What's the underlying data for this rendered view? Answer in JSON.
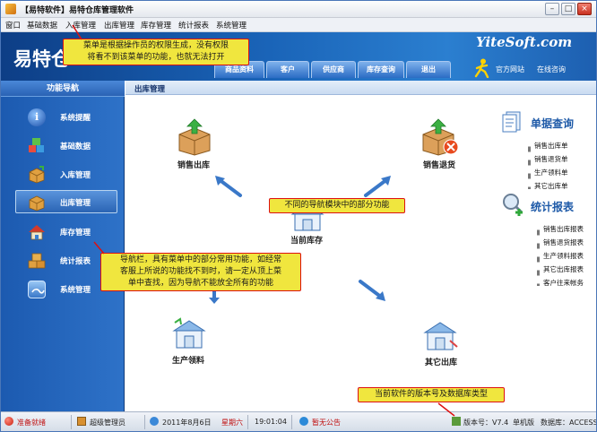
{
  "window": {
    "title": "【易特软件】易特仓库管理软件",
    "buttons": {
      "minimize": "–",
      "maximize": "□",
      "close": "×"
    }
  },
  "menubar": {
    "items": [
      "窗口",
      "基础数据",
      "入库管理",
      "出库管理",
      "库存管理",
      "统计报表",
      "系统管理"
    ]
  },
  "banner": {
    "logo_text": "易特仓",
    "brand": "YiteSoft.com",
    "nav_tabs": [
      "商品资料",
      "客户",
      "供应商",
      "库存查询",
      "退出"
    ],
    "links": [
      "官方网站",
      "在线咨询"
    ]
  },
  "sidebar": {
    "header": "功能导航",
    "items": [
      {
        "label": "系统提醒",
        "icon": "info-icon"
      },
      {
        "label": "基础数据",
        "icon": "cubes-icon"
      },
      {
        "label": "入库管理",
        "icon": "box-in-icon"
      },
      {
        "label": "出库管理",
        "icon": "box-out-icon",
        "active": true
      },
      {
        "label": "库存管理",
        "icon": "house-icon"
      },
      {
        "label": "统计报表",
        "icon": "boxes-icon"
      },
      {
        "label": "系统管理",
        "icon": "system-icon"
      }
    ]
  },
  "main": {
    "title": "出库管理",
    "modules": {
      "sales_out": "销售出库",
      "sales_return": "销售退货",
      "inventory": "当前库存",
      "production": "生产领料",
      "other_out": "其它出库"
    },
    "right_panel": {
      "query_title": "单据查询",
      "query_links": [
        "销售出库单",
        "销售退货单",
        "生产领料单",
        "其它出库单"
      ],
      "report_title": "统计报表",
      "report_links": [
        "销售出库报表",
        "销售退货报表",
        "生产领料报表",
        "其它出库报表",
        "客户往来帐务"
      ]
    }
  },
  "statusbar": {
    "ready": "准备就绪",
    "user": "超级管理员",
    "date": "2011年8月6日",
    "weekday": "星期六",
    "time": "19:01:04",
    "notice": "暂无公告",
    "version": "版本号：V7.4",
    "edition": "单机版",
    "database": "数据库：ACCESS"
  },
  "callouts": {
    "menu": [
      "菜单是根据操作员的权限生成，没有权限",
      "将看不到该菜单的功能，也就无法打开"
    ],
    "module": [
      "不同的导航模块中的部分功能"
    ],
    "sidebar": [
      "导航栏，具有菜单中的部分常用功能，如经常",
      "客服上所说的功能找不到时，请一定从顶上菜",
      "单中查找，因为导航不能放全所有的功能"
    ],
    "version": [
      "当前软件的版本号及数据库类型"
    ]
  },
  "colors": {
    "callout_bg": "#f0e63e",
    "callout_border": "#dd1111",
    "sidebar_bg": "#2466bc",
    "banner_bg": "#1a64b8",
    "accent_blue": "#1e5aa8"
  }
}
